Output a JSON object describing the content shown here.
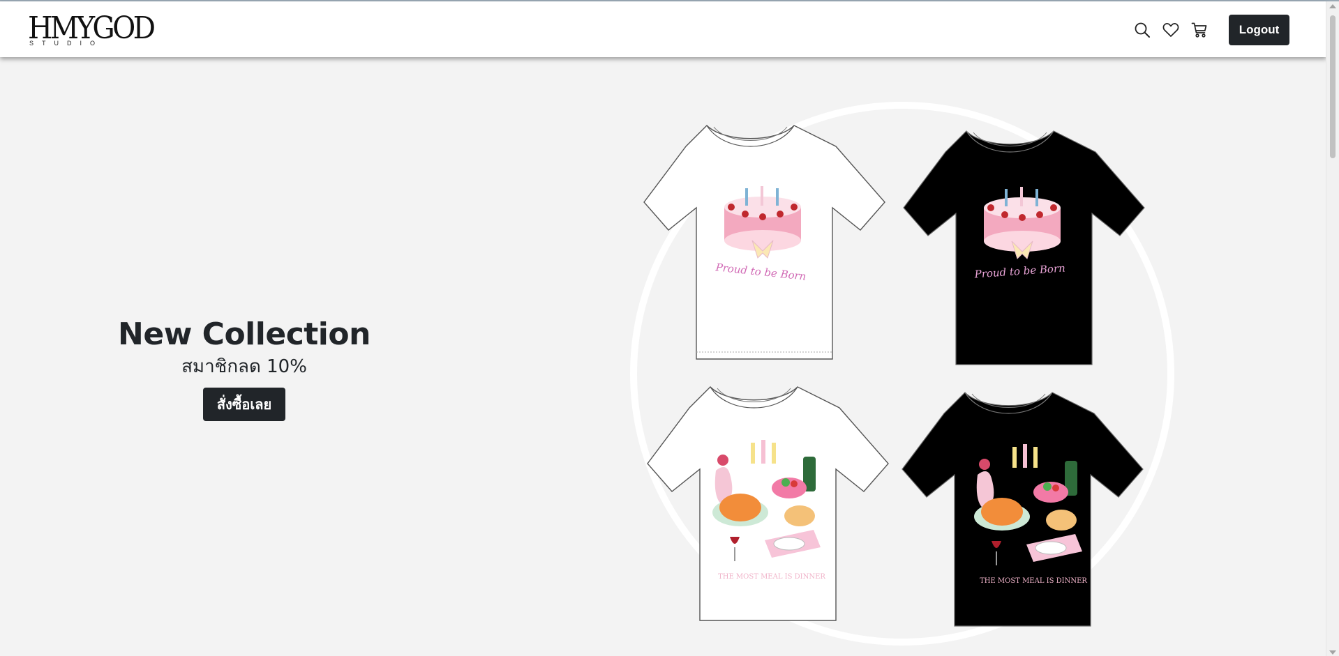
{
  "header": {
    "logo_text": "HMYGOD",
    "logo_subtext": "STUDIO",
    "icons": [
      "search-icon",
      "heart-icon",
      "cart-icon"
    ],
    "logout_label": "Logout"
  },
  "hero": {
    "title": "New Collection",
    "subtitle": "สมาชิกลด 10%",
    "button_label": "สั่งซื้อเลย",
    "shirts": [
      {
        "color": "white",
        "print": "Proud to be Born"
      },
      {
        "color": "black",
        "print": "Proud to be Born"
      },
      {
        "color": "white",
        "print": "THE MOST MEAL IS DINNER"
      },
      {
        "color": "black",
        "print": "THE MOST MEAL IS DINNER"
      }
    ]
  },
  "colors": {
    "background": "#f3f3f3",
    "header": "#ffffff",
    "button_dark": "#212529",
    "text_dark": "#212529"
  }
}
